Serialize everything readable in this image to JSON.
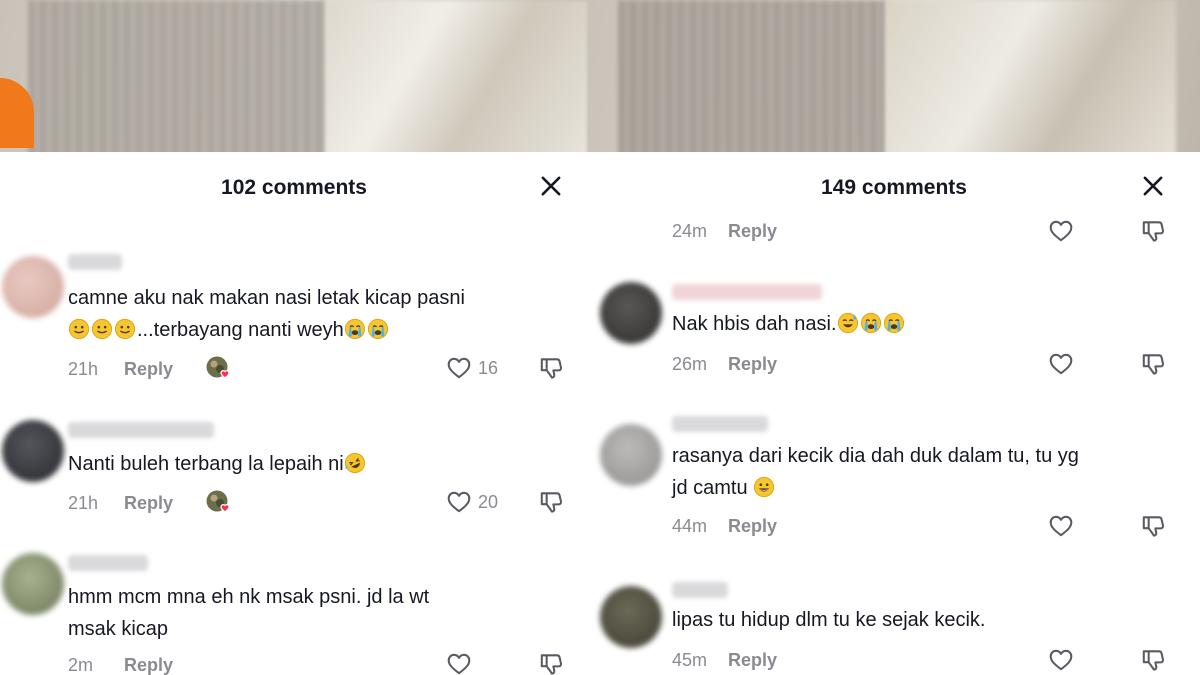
{
  "left": {
    "title": "102 comments",
    "comments": [
      {
        "text_line1": "camne aku nak makan nasi letak kicap pasni",
        "text_line2": "...terbayang nanti weyh",
        "time": "21h",
        "reply": "Reply",
        "likes": "16",
        "creator_liked": true
      },
      {
        "text_line1": "Nanti buleh terbang la lepaih ni",
        "time": "21h",
        "reply": "Reply",
        "likes": "20",
        "creator_liked": true
      },
      {
        "text_line1": "hmm mcm mna eh nk msak psni. jd la wt",
        "text_line2": "msak kicap",
        "time": "2m",
        "reply": "Reply",
        "likes": ""
      }
    ]
  },
  "right": {
    "title": "149 comments",
    "top_meta": {
      "time": "24m",
      "reply": "Reply"
    },
    "comments": [
      {
        "text_line1": "Nak hbis dah nasi.",
        "time": "26m",
        "reply": "Reply"
      },
      {
        "text_line1": "rasanya dari kecik dia dah duk dalam tu, tu yg",
        "text_line2": "jd camtu",
        "time": "44m",
        "reply": "Reply"
      },
      {
        "text_line1": "lipas tu hidup dlm tu ke sejak kecik.",
        "time": "45m",
        "reply": "Reply"
      }
    ]
  },
  "icons": {
    "close": "close-icon",
    "like": "heart-outline-icon",
    "dislike": "thumbs-down-icon",
    "emoji_smile": "slightly-smiling-face-emoji",
    "emoji_cry": "loudly-crying-face-emoji",
    "emoji_rofl": "rolling-on-floor-laughing-emoji",
    "emoji_sweat": "grinning-face-with-sweat-emoji",
    "emoji_grin": "grinning-face-emoji"
  },
  "colors": {
    "text": "#161823",
    "muted": "#8a8b91",
    "video_orange": "#f07a1a"
  }
}
